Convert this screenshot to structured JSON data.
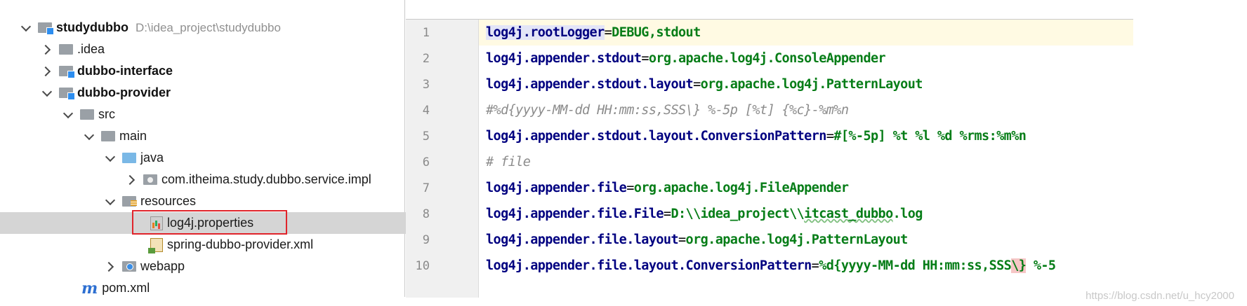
{
  "tree": {
    "root": {
      "label": "studydubbo",
      "path": "D:\\idea_project\\studydubbo"
    },
    "items": [
      {
        "label": ".idea"
      },
      {
        "label": "dubbo-interface"
      },
      {
        "label": "dubbo-provider"
      },
      {
        "label": "src"
      },
      {
        "label": "main"
      },
      {
        "label": "java"
      },
      {
        "label": "com.itheima.study.dubbo.service.impl"
      },
      {
        "label": "resources"
      },
      {
        "label": "log4j.properties"
      },
      {
        "label": "spring-dubbo-provider.xml"
      },
      {
        "label": "webapp"
      },
      {
        "label": "pom.xml"
      }
    ],
    "selected": "log4j.properties"
  },
  "editor": {
    "file": "log4j.properties",
    "current_line": 1,
    "lines": [
      {
        "n": "1",
        "key": "log4j.rootLogger",
        "eq": "=",
        "val": "DEBUG,stdout"
      },
      {
        "n": "2",
        "key": "log4j.appender.stdout",
        "eq": "=",
        "val": "org.apache.log4j.ConsoleAppender"
      },
      {
        "n": "3",
        "key": "log4j.appender.stdout.layout",
        "eq": "=",
        "val": "org.apache.log4j.PatternLayout"
      },
      {
        "n": "4",
        "comment": "#%d{yyyy-MM-dd HH:mm:ss,SSS\\} %-5p [%t] {%c}-%m%n"
      },
      {
        "n": "5",
        "key": "log4j.appender.stdout.layout.ConversionPattern",
        "eq": "=",
        "val": "#[%-5p] %t %l %d %rms:%m%n"
      },
      {
        "n": "6",
        "comment": "# file"
      },
      {
        "n": "7",
        "key": "log4j.appender.file",
        "eq": "=",
        "val": "org.apache.log4j.FileAppender"
      },
      {
        "n": "8",
        "key": "log4j.appender.file.File",
        "eq": "=",
        "val_a": "D:\\\\idea_project\\\\",
        "val_b": "itcast_dubbo",
        "val_c": ".log"
      },
      {
        "n": "9",
        "key": "log4j.appender.file.layout",
        "eq": "=",
        "val": "org.apache.log4j.PatternLayout"
      },
      {
        "n": "10",
        "key": "log4j.appender.file.layout.ConversionPattern",
        "eq": "=",
        "val_a": "%d{yyyy-MM-dd HH:mm:ss,SSS",
        "val_b": "\\}",
        "val_c": " %-5"
      }
    ]
  },
  "watermark": "https://blog.csdn.net/u_hcy2000",
  "colors": {
    "selection_box": "#e0242b",
    "current_line": "#fffae3",
    "key": "#000080",
    "value": "#067d17"
  }
}
